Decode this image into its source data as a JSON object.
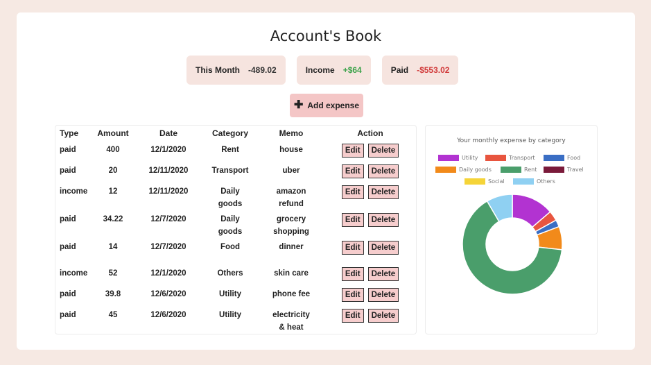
{
  "title": "Account's Book",
  "stats": [
    {
      "label": "This Month",
      "value": "-489.02",
      "tone": "neutral"
    },
    {
      "label": "Income",
      "value": "+$64",
      "tone": "pos"
    },
    {
      "label": "Paid",
      "value": "-$553.02",
      "tone": "neg"
    }
  ],
  "add_button": {
    "label": "Add expense"
  },
  "table": {
    "headers": [
      "Type",
      "Amount",
      "Date",
      "Category",
      "Memo",
      "Action"
    ],
    "rows": [
      {
        "type": "paid",
        "amount": "400",
        "date": "12/1/2020",
        "category": "Rent",
        "memo": "house"
      },
      {
        "type": "paid",
        "amount": "20",
        "date": "12/11/2020",
        "category": "Transport",
        "memo": "uber"
      },
      {
        "type": "income",
        "amount": "12",
        "date": "12/11/2020",
        "category": "Daily\ngoods",
        "memo": "amazon\nrefund"
      },
      {
        "type": "paid",
        "amount": "34.22",
        "date": "12/7/2020",
        "category": "Daily\ngoods",
        "memo": "grocery\nshopping"
      },
      {
        "type": "paid",
        "amount": "14",
        "date": "12/7/2020",
        "category": "Food",
        "memo": "dinner"
      },
      {
        "type": "income",
        "amount": "52",
        "date": "12/1/2020",
        "category": "Others",
        "memo": "skin care"
      },
      {
        "type": "paid",
        "amount": "39.8",
        "date": "12/6/2020",
        "category": "Utility",
        "memo": "phone fee"
      },
      {
        "type": "paid",
        "amount": "45",
        "date": "12/6/2020",
        "category": "Utility",
        "memo": "electricity\n& heat"
      }
    ],
    "edit_label": "Edit",
    "delete_label": "Delete"
  },
  "chart_data": {
    "type": "pie",
    "title": "Your monthly expense by category",
    "categories": [
      "Utility",
      "Transport",
      "Food",
      "Daily goods",
      "Rent",
      "Travel",
      "Social",
      "Others"
    ],
    "values": [
      84.8,
      20,
      14,
      46.22,
      400,
      0,
      0,
      52
    ],
    "colors": [
      "#b233d1",
      "#e8553f",
      "#3a6ec4",
      "#f28a1a",
      "#4a9e6b",
      "#7a1a3a",
      "#f5d438",
      "#8fd0f2"
    ],
    "donut": true
  }
}
